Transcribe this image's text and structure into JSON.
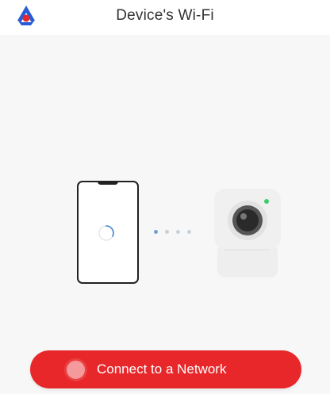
{
  "header": {
    "title": "Device's Wi-Fi",
    "logo_icon": "brand-logo-icon"
  },
  "illustration": {
    "phone_icon": "phone-icon",
    "spinner_icon": "loading-spinner-icon",
    "camera_icon": "camera-icon",
    "connection_dots": [
      "active",
      "inactive",
      "inactive",
      "inactive"
    ]
  },
  "actions": {
    "connect_label": "Connect to a Network"
  },
  "colors": {
    "accent": "#e8272a",
    "logo_blue": "#2a5bd7",
    "logo_red": "#e8272a",
    "dot_active": "#6f9fd8",
    "dot_inactive": "#c8d0d8",
    "camera_status_green": "#3ecf6b"
  }
}
